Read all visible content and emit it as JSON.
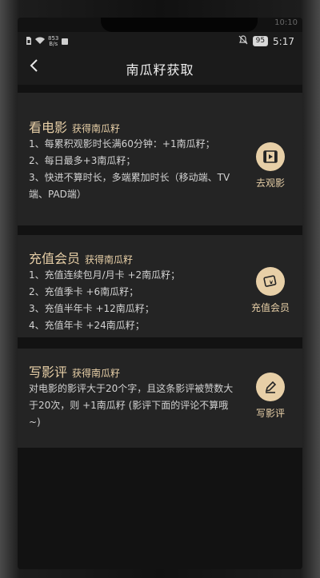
{
  "status_bar": {
    "top_left_hint": "",
    "top_right_hint": "10:10",
    "net_speed_value": "853",
    "net_speed_unit": "B/s",
    "battery": "95",
    "time": "5:17"
  },
  "nav": {
    "title": "南瓜籽获取"
  },
  "cards": [
    {
      "title": "看电影",
      "subtitle": "获得南瓜籽",
      "lines": [
        "1、每累积观影时长满60分钟：+1南瓜籽；",
        "2、每日最多+3南瓜籽；",
        "3、快进不算时长，多端累加时长（移动端、TV端、PAD端）"
      ],
      "action_label": "去观影",
      "action_icon": "film-icon"
    },
    {
      "title": "充值会员",
      "subtitle": "获得南瓜籽",
      "lines": [
        "1、充值连续包月/月卡 +2南瓜籽；",
        "2、充值季卡 +6南瓜籽；",
        "3、充值半年卡 +12南瓜籽；",
        "4、充值年卡 +24南瓜籽；"
      ],
      "action_label": "充值会员",
      "action_icon": "vip-card-icon"
    },
    {
      "title": "写影评",
      "subtitle": "获得南瓜籽",
      "lines": [
        "对电影的影评大于20个字，且这条影评被赞数大于20次，则 +1南瓜籽 (影评下面的评论不算哦~)"
      ],
      "action_label": "写影评",
      "action_icon": "pencil-icon"
    }
  ],
  "colors": {
    "accent": "#e7cfa7",
    "background": "#121212",
    "card": "#242424"
  }
}
